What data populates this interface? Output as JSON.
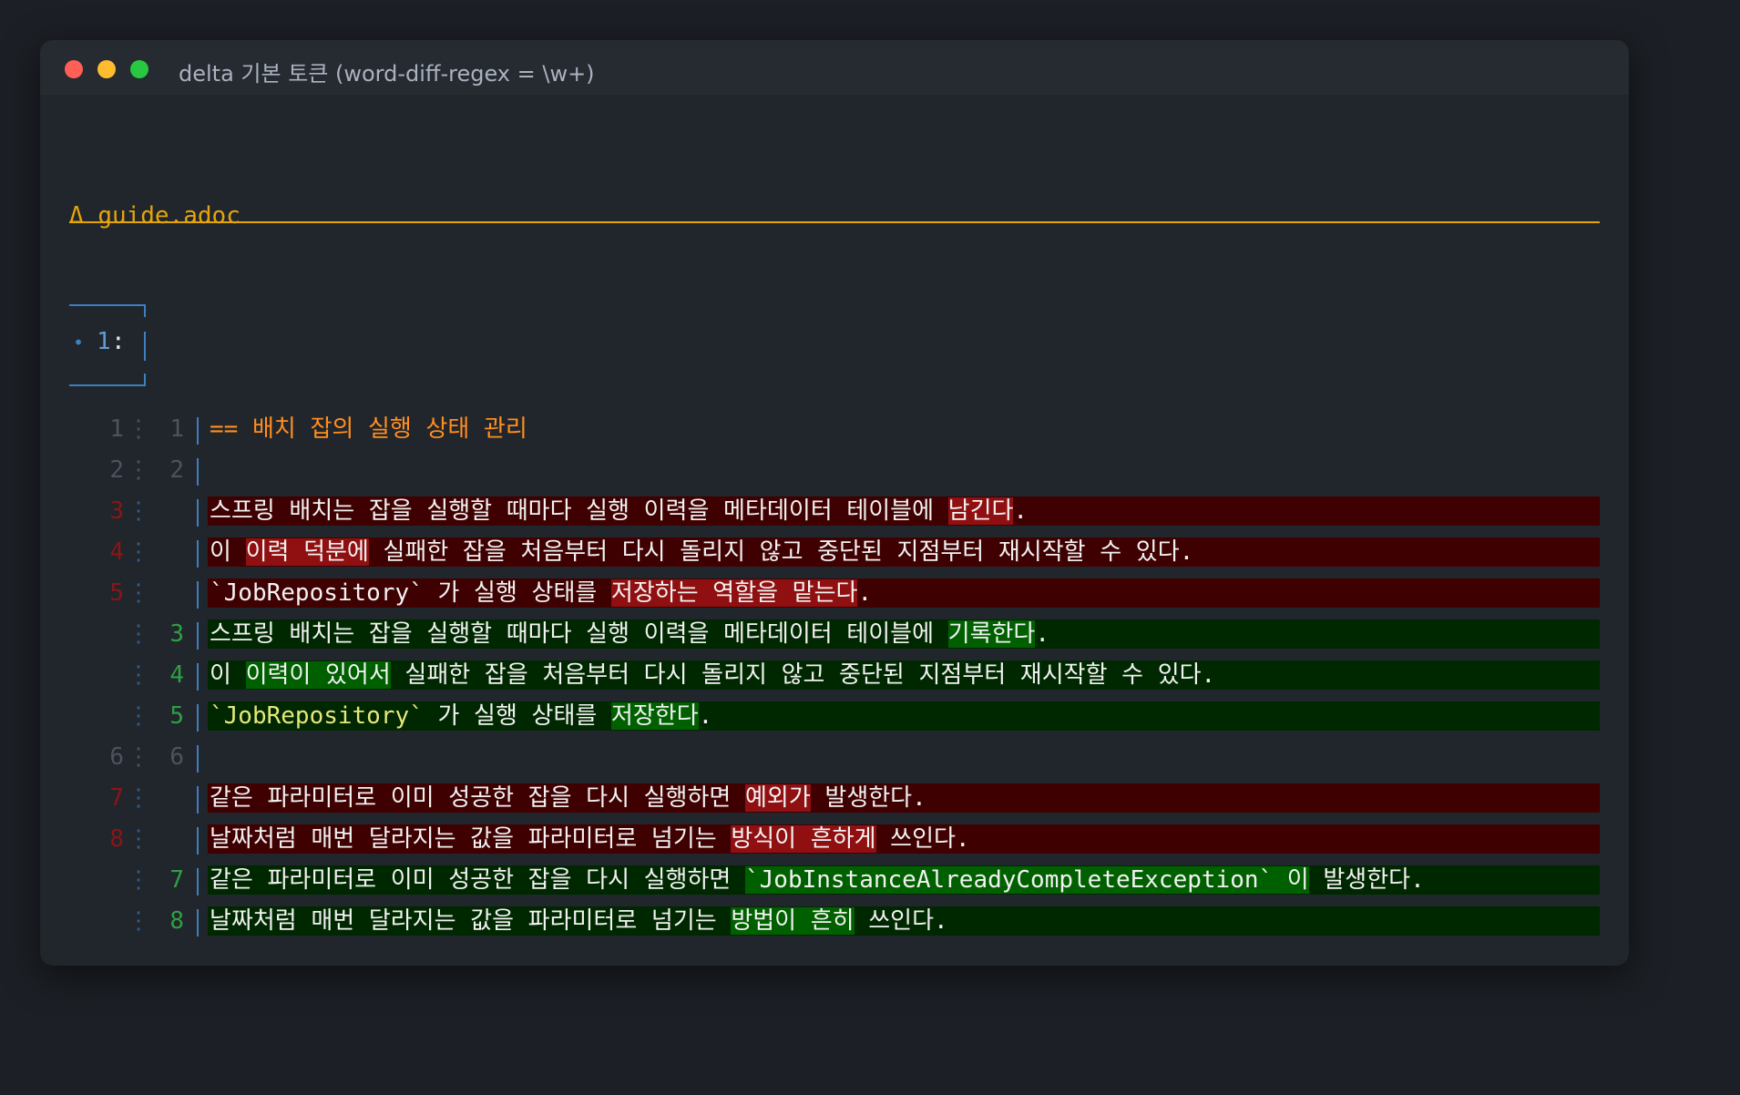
{
  "window": {
    "title": "delta 기본 토큰 (word-diff-regex = \\w+)",
    "controls": [
      "close",
      "minimize",
      "maximize"
    ]
  },
  "file": {
    "symbol": "Δ",
    "name": "guide.adoc"
  },
  "hunk": {
    "marker": "•",
    "number": "1",
    "colon": ":"
  },
  "diff_lines": [
    {
      "type": "context",
      "old": "1",
      "new": "1",
      "segments": [
        {
          "text": "== 배치 잡의 실행 상태 관리",
          "hl": false
        }
      ]
    },
    {
      "type": "context",
      "old": "2",
      "new": "2",
      "segments": []
    },
    {
      "type": "minus",
      "old": "3",
      "new": "",
      "segments": [
        {
          "text": "스프링 배치는 잡을 실행할 때마다 실행 이력을 메타데이터 테이블에 ",
          "hl": false
        },
        {
          "text": "남긴다",
          "hl": true
        },
        {
          "text": ".",
          "hl": false
        }
      ]
    },
    {
      "type": "minus",
      "old": "4",
      "new": "",
      "segments": [
        {
          "text": "이 ",
          "hl": false
        },
        {
          "text": "이력 덕분에",
          "hl": true
        },
        {
          "text": " 실패한 잡을 처음부터 다시 돌리지 않고 중단된 지점부터 재시작할 수 있다.",
          "hl": false
        }
      ]
    },
    {
      "type": "minus",
      "old": "5",
      "new": "",
      "segments": [
        {
          "text": "`JobRepository` 가 실행 상태를 ",
          "hl": false
        },
        {
          "text": "저장하는 역할을 맡는다",
          "hl": true
        },
        {
          "text": ".",
          "hl": false
        }
      ]
    },
    {
      "type": "plus",
      "old": "",
      "new": "3",
      "segments": [
        {
          "text": "스프링 배치는 잡을 실행할 때마다 실행 이력을 메타데이터 테이블에 ",
          "hl": false
        },
        {
          "text": "기록한다",
          "hl": true
        },
        {
          "text": ".",
          "hl": false
        }
      ]
    },
    {
      "type": "plus",
      "old": "",
      "new": "4",
      "segments": [
        {
          "text": "이 ",
          "hl": false
        },
        {
          "text": "이력이 있어서",
          "hl": true
        },
        {
          "text": " 실패한 잡을 처음부터 다시 돌리지 않고 중단된 지점부터 재시작할 수 있다.",
          "hl": false
        }
      ]
    },
    {
      "type": "plus",
      "old": "",
      "new": "5",
      "segments": [
        {
          "text": "`JobRepository`",
          "hl": false,
          "tick": true
        },
        {
          "text": " 가 실행 상태를 ",
          "hl": false
        },
        {
          "text": "저장한다",
          "hl": true
        },
        {
          "text": ".",
          "hl": false
        }
      ]
    },
    {
      "type": "context",
      "old": "6",
      "new": "6",
      "segments": []
    },
    {
      "type": "minus",
      "old": "7",
      "new": "",
      "segments": [
        {
          "text": "같은 파라미터로 이미 성공한 잡을 다시 실행하면 ",
          "hl": false
        },
        {
          "text": "예외가",
          "hl": true
        },
        {
          "text": " 발생한다.",
          "hl": false
        }
      ]
    },
    {
      "type": "minus",
      "old": "8",
      "new": "",
      "segments": [
        {
          "text": "날짜처럼 매번 달라지는 값을 파라미터로 넘기는 ",
          "hl": false
        },
        {
          "text": "방식이 흔하게",
          "hl": true
        },
        {
          "text": " 쓰인다.",
          "hl": false
        }
      ]
    },
    {
      "type": "plus",
      "old": "",
      "new": "7",
      "segments": [
        {
          "text": "같은 파라미터로 이미 성공한 잡을 다시 실행하면 ",
          "hl": false
        },
        {
          "text": "`JobInstanceAlreadyCompleteException` 이",
          "hl": true
        },
        {
          "text": " 발생한다.",
          "hl": false
        }
      ]
    },
    {
      "type": "plus",
      "old": "",
      "new": "8",
      "segments": [
        {
          "text": "날짜처럼 매번 달라지는 값을 파라미터로 넘기는 ",
          "hl": false
        },
        {
          "text": "방법이 흔히",
          "hl": true
        },
        {
          "text": " 쓰인다.",
          "hl": false
        }
      ]
    }
  ],
  "colors": {
    "minus_line_bg": "#3f0001",
    "minus_token_bg": "#901011",
    "plus_line_bg": "#002800",
    "plus_token_bg": "#006000",
    "file_header": "#e5a50a",
    "hunk_box": "#3e7fbf",
    "heading_text": "#ff8f1f"
  }
}
